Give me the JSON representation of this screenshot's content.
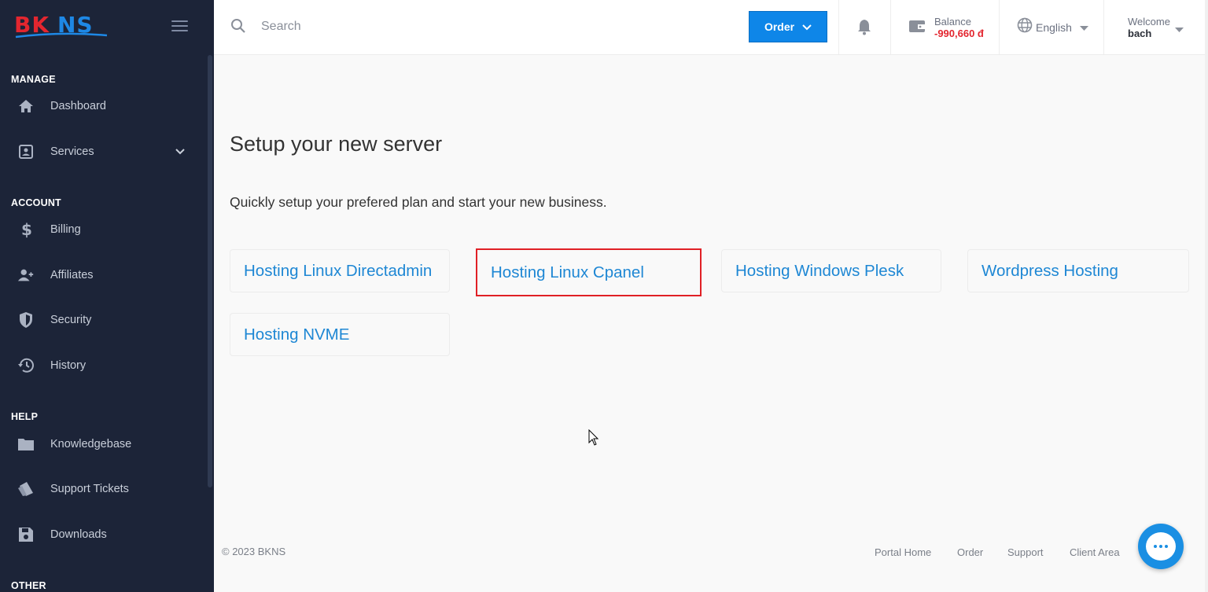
{
  "brand": {
    "logo_text": "BKNS",
    "logo_colors": [
      "#e3262f",
      "#1e88e5"
    ]
  },
  "sidebar": {
    "sections": [
      {
        "label": "MANAGE"
      },
      {
        "label": "ACCOUNT"
      },
      {
        "label": "HELP"
      },
      {
        "label": "OTHER"
      }
    ],
    "items": [
      {
        "label": "Dashboard",
        "icon": "home-icon"
      },
      {
        "label": "Services",
        "icon": "user-card-icon"
      },
      {
        "label": "Billing",
        "icon": "dollar-icon"
      },
      {
        "label": "Affiliates",
        "icon": "add-user-icon"
      },
      {
        "label": "Security",
        "icon": "shield-icon"
      },
      {
        "label": "History",
        "icon": "history-icon"
      },
      {
        "label": "Knowledgebase",
        "icon": "folder-icon"
      },
      {
        "label": "Support Tickets",
        "icon": "ticket-icon"
      },
      {
        "label": "Downloads",
        "icon": "save-icon"
      }
    ]
  },
  "header": {
    "search_placeholder": "Search",
    "order_label": "Order",
    "balance_label": "Balance",
    "balance_value": "-990,660 đ",
    "language": "English",
    "welcome_label": "Welcome",
    "username": "bach"
  },
  "main": {
    "title": "Setup your new server",
    "subtitle": "Quickly setup your prefered plan and start your new business.",
    "plans": [
      {
        "label": "Hosting Linux Directadmin"
      },
      {
        "label": "Hosting Linux Cpanel"
      },
      {
        "label": "Hosting Windows Plesk"
      },
      {
        "label": "Wordpress Hosting"
      },
      {
        "label": "Hosting NVME"
      }
    ]
  },
  "footer": {
    "copyright": "© 2023 BKNS",
    "links": [
      "Portal Home",
      "Order",
      "Support",
      "Client Area"
    ]
  },
  "colors": {
    "sidebar_bg": "#1c2438",
    "accent": "#0e86e8",
    "link": "#1e87d4",
    "highlight_border": "#e02026",
    "balance_negative": "#e3262f"
  }
}
